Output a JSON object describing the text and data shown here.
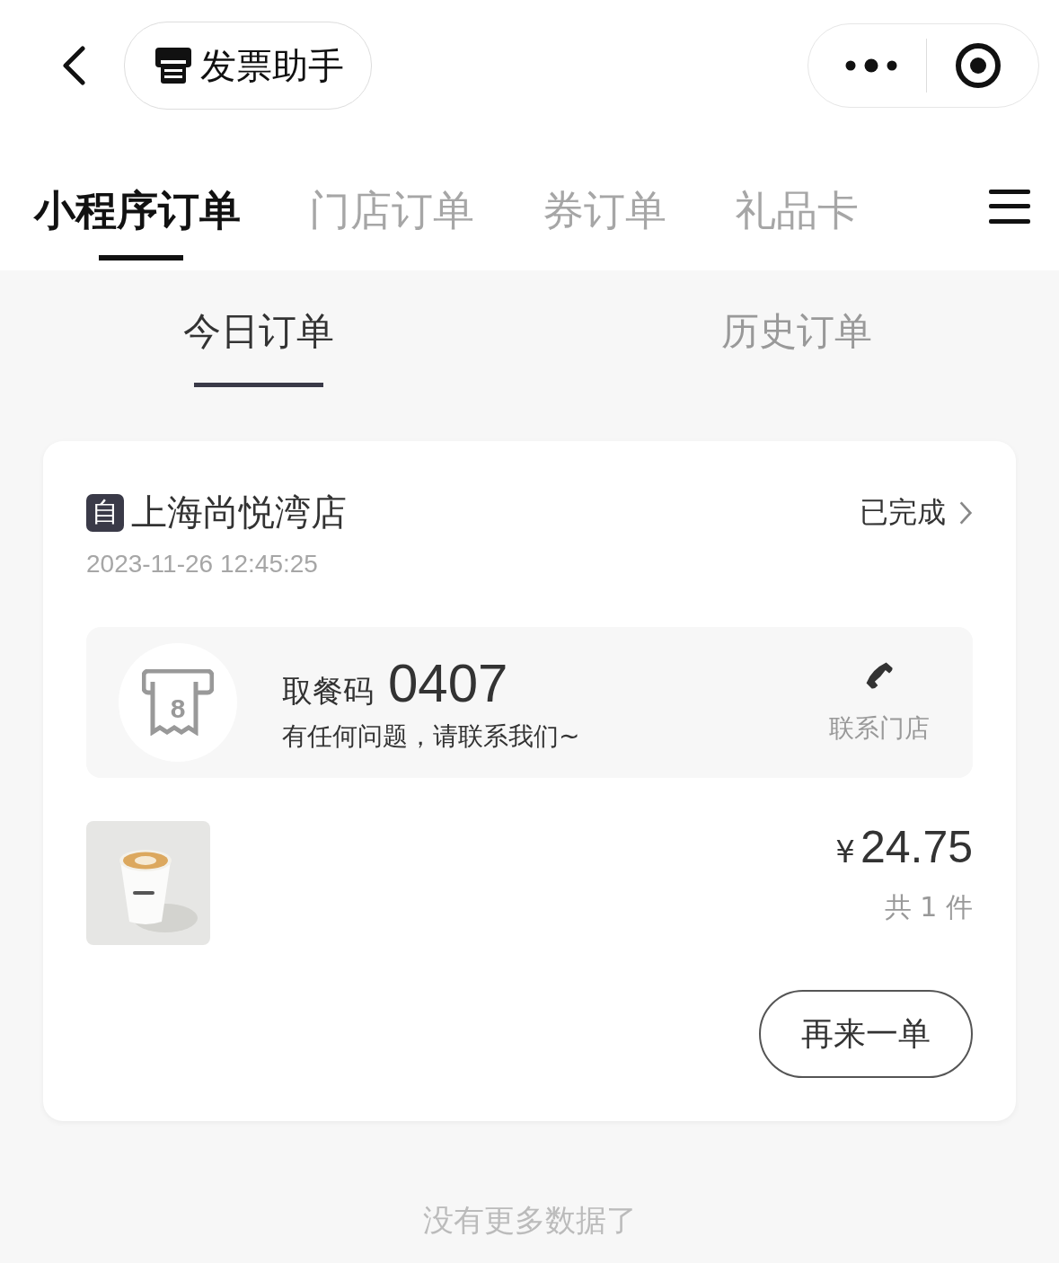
{
  "top_bar": {
    "title": "发票助手"
  },
  "tabs": [
    {
      "label": "小程序订单",
      "selected": true
    },
    {
      "label": "门店订单",
      "selected": false
    },
    {
      "label": "券订单",
      "selected": false
    },
    {
      "label": "礼品卡",
      "selected": false
    }
  ],
  "sub_tabs": [
    {
      "label": "今日订单",
      "selected": true
    },
    {
      "label": "历史订单",
      "selected": false
    }
  ],
  "orders": [
    {
      "badge": "自",
      "store": "上海尚悦湾店",
      "status": "已完成",
      "time": "2023-11-26 12:45:25",
      "pickup_label": "取餐码",
      "pickup_code": "0407",
      "ticket_number": "8",
      "help_text": "有任何问题，请联系我们~",
      "contact": "联系门店",
      "currency": "¥",
      "amount": "24.75",
      "count": "共 1 件",
      "reorder": "再来一单"
    }
  ],
  "footer": "没有更多数据了"
}
